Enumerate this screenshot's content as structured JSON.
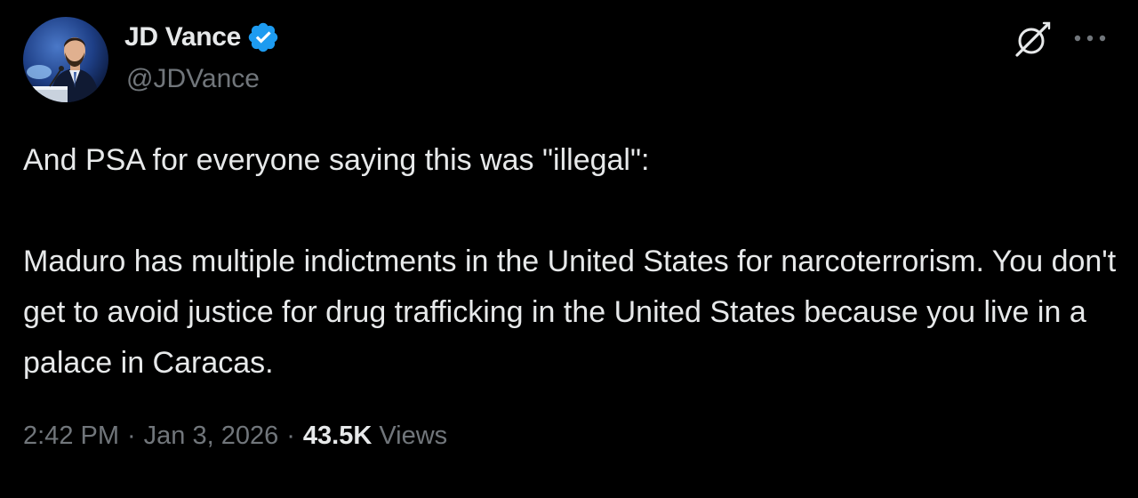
{
  "author": {
    "display_name": "JD Vance",
    "handle": "@JDVance",
    "verified": true,
    "verified_color": "#1d9bf0",
    "avatar_icon": "profile-photo"
  },
  "tweet": {
    "paragraphs": [
      "And PSA for everyone saying this was \"illegal\":",
      "Maduro has multiple indictments in the United States for narcoterrorism. You don't get to avoid justice for drug trafficking in the United States because you live in a palace in Caracas."
    ]
  },
  "meta": {
    "time": "2:42 PM",
    "separator": "·",
    "date": "Jan 3, 2026",
    "views_count": "43.5K",
    "views_label": "Views"
  },
  "actions": {
    "grok_icon": "grok-icon",
    "more_icon": "more-icon"
  },
  "colors": {
    "background": "#000000",
    "primary_text": "#e7e9ea",
    "secondary_text": "#71767b"
  }
}
